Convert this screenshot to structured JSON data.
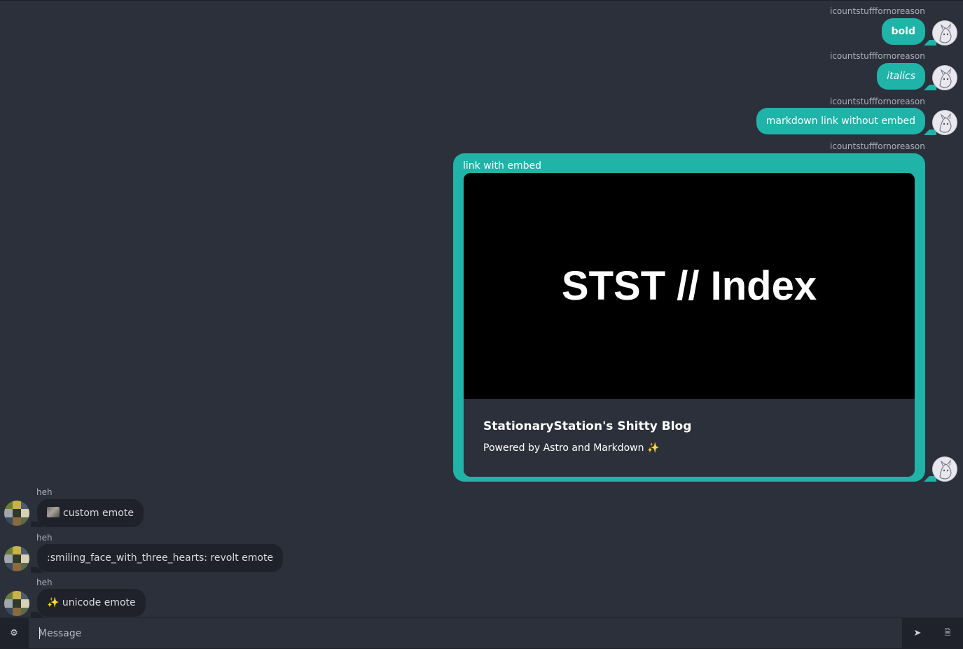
{
  "messages_out": [
    {
      "author": "icountstufffornoreason",
      "text": "bold"
    },
    {
      "author": "icountstufffornoreason",
      "text": "italics"
    },
    {
      "author": "icountstufffornoreason",
      "text": "markdown link without embed"
    },
    {
      "author": "icountstufffornoreason",
      "text": "link with embed",
      "embed": {
        "image_text": "STST // Index",
        "title": "StationaryStation's Shitty Blog",
        "description": "Powered by Astro and Markdown ✨"
      }
    }
  ],
  "messages_in": [
    {
      "author": "heh",
      "text": "custom emote",
      "emote": "custom-emote-image"
    },
    {
      "author": "heh",
      "text": ":smiling_face_with_three_hearts: revolt emote"
    },
    {
      "author": "heh",
      "text": "✨ unicode emote"
    }
  ],
  "composer": {
    "placeholder": "Message",
    "settings_icon": "⚙",
    "send_icon": "➤",
    "attach_icon": "🗎"
  },
  "colors": {
    "background": "#2b303b",
    "outgoing_bubble": "#20b3a8",
    "incoming_bubble": "#1f222a"
  }
}
